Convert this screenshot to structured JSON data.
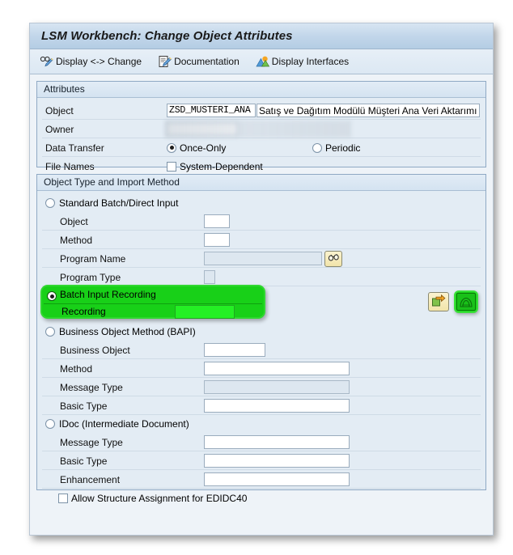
{
  "window": {
    "title": "LSM Workbench: Change Object Attributes"
  },
  "toolbar": {
    "items": [
      {
        "label": "Display <-> Change",
        "icon": "glasses-pencil-icon"
      },
      {
        "label": "Documentation",
        "icon": "document-pencil-icon"
      },
      {
        "label": "Display Interfaces",
        "icon": "image-mountains-icon"
      }
    ]
  },
  "attributes": {
    "group_title": "Attributes",
    "object_label": "Object",
    "object_value": "ZSD_MUSTERI_ANA",
    "object_description": "Satış ve Dağıtım Modülü Müşteri Ana Veri Aktarımı",
    "owner_label": "Owner",
    "owner_value": "",
    "owner_name": "",
    "data_transfer_label": "Data Transfer",
    "once_only_label": "Once-Only",
    "once_only_selected": true,
    "periodic_label": "Periodic",
    "periodic_selected": false,
    "file_names_label": "File Names",
    "system_dependent_label": "System-Dependent",
    "system_dependent_checked": false
  },
  "object_type": {
    "group_title": "Object Type and Import Method",
    "standard": {
      "radio_label": "Standard Batch/Direct Input",
      "selected": false,
      "object_label": "Object",
      "object_value": "",
      "method_label": "Method",
      "method_value": "",
      "program_name_label": "Program Name",
      "program_name_value": "",
      "program_type_label": "Program Type",
      "program_type_value": "",
      "search_help_icon": "binoculars-icon"
    },
    "batch_recording": {
      "radio_label": "Batch Input Recording",
      "selected": true,
      "recording_label": "Recording",
      "recording_value": "",
      "highlighted": true
    },
    "bapi": {
      "radio_label": "Business Object Method  (BAPI)",
      "selected": false,
      "business_object_label": "Business Object",
      "business_object_value": "",
      "method_label": "Method",
      "method_value": "",
      "message_type_label": "Message Type",
      "message_type_value": "",
      "basic_type_label": "Basic Type",
      "basic_type_value": ""
    },
    "idoc": {
      "radio_label": "IDoc (Intermediate Document)",
      "selected": false,
      "message_type_label": "Message Type",
      "message_type_value": "",
      "basic_type_label": "Basic Type",
      "basic_type_value": "",
      "enhancement_label": "Enhancement",
      "enhancement_value": "",
      "allow_structure_label": "Allow Structure Assignment for EDIDC40",
      "allow_structure_checked": false
    },
    "actions": {
      "overview_icon": "arrow-into-box-icon",
      "record_icon": "recording-overwrite-icon"
    }
  },
  "colors": {
    "highlight_green": "#18d018",
    "highlight_field_green": "#24f024",
    "panel_blue": "#e3ecf4",
    "title_blue": "#b4cde4"
  }
}
